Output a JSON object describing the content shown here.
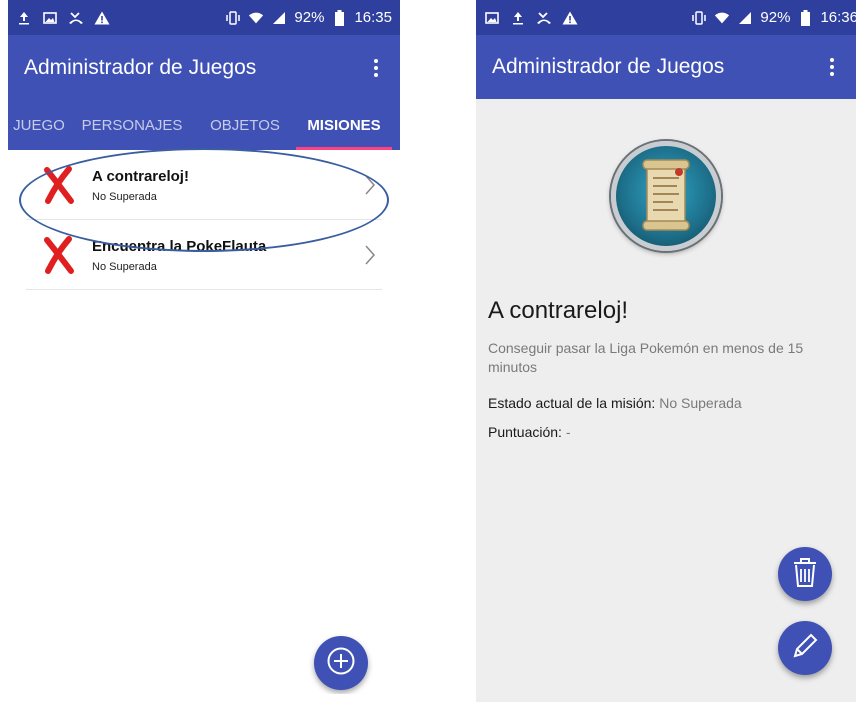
{
  "left": {
    "status": {
      "battery": "92%",
      "time": "16:35"
    },
    "appbar": {
      "title": "Administrador de Juegos"
    },
    "tabs": [
      {
        "label": "JUEGO"
      },
      {
        "label": "PERSONAJES"
      },
      {
        "label": "OBJETOS"
      },
      {
        "label": "MISIONES"
      }
    ],
    "missions": [
      {
        "title": "A contrareloj!",
        "status": "No Superada"
      },
      {
        "title": "Encuentra la PokeFlauta",
        "status": "No Superada"
      }
    ]
  },
  "right": {
    "status": {
      "battery": "92%",
      "time": "16:36"
    },
    "appbar": {
      "title": "Administrador de Juegos"
    },
    "detail": {
      "title": "A contrareloj!",
      "description": "Conseguir pasar la Liga Pokemón en menos de 15 minutos",
      "state_label": "Estado actual de la misión:",
      "state_value": "No Superada",
      "score_label": "Puntuación:",
      "score_value": "-"
    }
  },
  "colors": {
    "primary": "#3f51b5",
    "statusbar": "#2f3f9e",
    "accent": "#ff4081",
    "fail": "#e02020"
  },
  "icons": [
    "upload-icon",
    "image-icon",
    "missed-call-icon",
    "warning-icon",
    "vibrate-icon",
    "wifi-icon",
    "signal-icon",
    "battery-icon",
    "overflow-menu-icon",
    "x-mark-icon",
    "chevron-right-icon",
    "add-icon",
    "trash-icon",
    "pencil-icon",
    "scroll-icon"
  ]
}
